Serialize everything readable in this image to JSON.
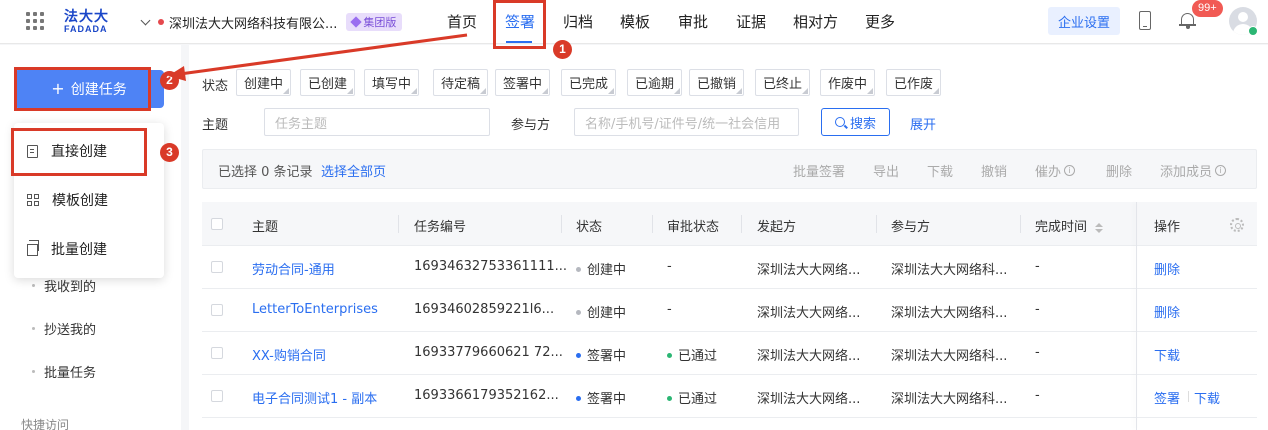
{
  "topnav": {
    "logo_cn": "法大大",
    "logo_en": "FADADA",
    "company": "深圳法大大网络科技有限公...",
    "edition_badge": "集团版",
    "nav": [
      "首页",
      "签署",
      "归档",
      "模板",
      "审批",
      "证据",
      "相对方",
      "更多"
    ],
    "active_nav": "签署",
    "enterprise_settings": "企业设置",
    "notification_count": "99+"
  },
  "sidebar": {
    "create_button": "创建任务",
    "create_plus": "+",
    "dropdown": [
      "直接创建",
      "模板创建",
      "批量创建"
    ],
    "links": [
      "我收到的",
      "抄送我的",
      "批量任务"
    ],
    "quick_access": "快捷访问"
  },
  "filters": {
    "status_label": "状态",
    "statuses": [
      "创建中",
      "已创建",
      "填写中",
      "待定稿",
      "签署中",
      "已完成",
      "已逾期",
      "已撤销",
      "已终止",
      "作废中",
      "已作废"
    ],
    "subject_label": "主题",
    "subject_placeholder": "任务主题",
    "party_label": "参与方",
    "party_placeholder": "名称/手机号/证件号/统一社会信用",
    "search": "搜索",
    "expand": "展开"
  },
  "toolbar": {
    "selected_text": "已选择 0 条记录",
    "select_all": "选择全部页",
    "actions": [
      "批量签署",
      "导出",
      "下载",
      "撤销",
      "催办",
      "删除",
      "添加成员"
    ]
  },
  "table": {
    "headers": [
      "主题",
      "任务编号",
      "状态",
      "审批状态",
      "发起方",
      "参与方",
      "完成时间",
      "操作"
    ],
    "rows": [
      {
        "subject": "劳动合同-通用",
        "id": "16934632753361111...",
        "status": "创建中",
        "status_color": "#b5b8bf",
        "approval": "-",
        "approval_color": "",
        "initiator": "深圳法大大网络...",
        "party": "深圳法大大网络科...",
        "done": "-",
        "ops": [
          "删除"
        ]
      },
      {
        "subject": "LetterToEnterprises",
        "id": "16934602859221l6...",
        "status": "创建中",
        "status_color": "#b5b8bf",
        "approval": "-",
        "approval_color": "",
        "initiator": "深圳法大大网络...",
        "party": "深圳法大大网络科...",
        "done": "-",
        "ops": [
          "删除"
        ]
      },
      {
        "subject": "XX-购销合同",
        "id": "16933779660621 72...",
        "status": "签署中",
        "status_color": "#2a6ef0",
        "approval": "已通过",
        "approval_color": "#2bb673",
        "initiator": "深圳法大大网络...",
        "party": "深圳法大大网络科...",
        "done": "-",
        "ops": [
          "下载"
        ]
      },
      {
        "subject": "电子合同测试1 - 副本",
        "id": "1693366179352162...",
        "status": "签署中",
        "status_color": "#2a6ef0",
        "approval": "已通过",
        "approval_color": "#2bb673",
        "initiator": "深圳法大大网络...",
        "party": "深圳法大大网络科...",
        "done": "-",
        "ops": [
          "签署",
          "下载"
        ]
      }
    ]
  },
  "annotations": [
    "1",
    "2",
    "3"
  ],
  "colors": {
    "primary": "#2a6ef0",
    "annotation": "#d93a28",
    "button": "#4e83f5"
  }
}
